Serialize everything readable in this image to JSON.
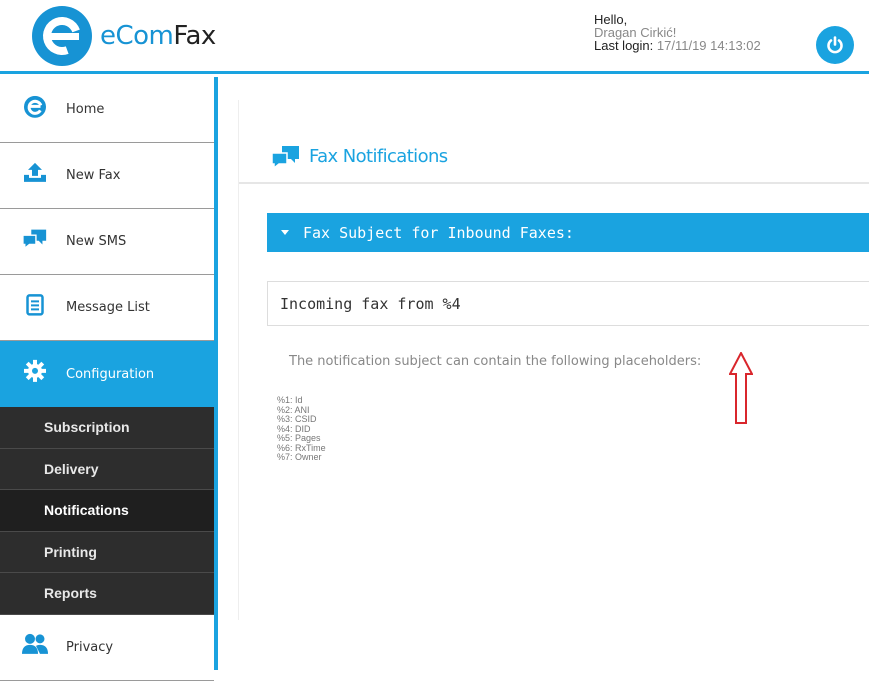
{
  "header": {
    "logo_text_prefix": "eCom",
    "logo_text_suffix": "Fax",
    "greeting": "Hello,",
    "user_name": "Dragan Cirkić!",
    "last_login_label": "Last login:",
    "last_login_value": "17/11/19 14:13:02"
  },
  "sidebar": {
    "items": [
      {
        "label": "Home",
        "icon": "ecomfax-e-icon"
      },
      {
        "label": "New Fax",
        "icon": "upload-icon"
      },
      {
        "label": "New SMS",
        "icon": "chat-bubbles-icon"
      },
      {
        "label": "Message List",
        "icon": "document-list-icon"
      },
      {
        "label": "Configuration",
        "icon": "gear-icon"
      }
    ],
    "subitems": [
      "Subscription",
      "Delivery",
      "Notifications",
      "Printing",
      "Reports"
    ],
    "last_item": {
      "label": "Privacy",
      "icon": "users-icon"
    }
  },
  "main": {
    "page_title": "Fax Notifications",
    "section_title": "Fax Subject for Inbound Faxes:",
    "subject_value": "Incoming fax from %4",
    "hint": "The notification subject can contain the following placeholders:",
    "placeholders": [
      "%1: Id",
      "%2: ANI",
      "%3: CSID",
      "%4: DID",
      "%5: Pages",
      "%6: RxTime",
      "%7: Owner"
    ]
  },
  "colors": {
    "accent": "#1aa3e0",
    "submenu_bg": "#2d2d2d",
    "annotation_arrow": "#d9262c"
  }
}
